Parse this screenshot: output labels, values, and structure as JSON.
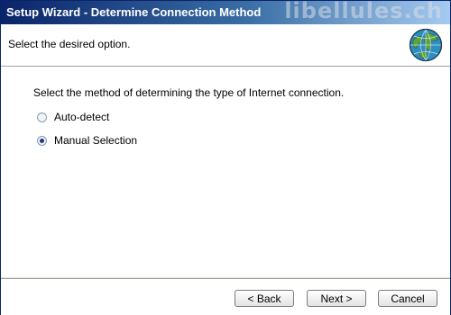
{
  "window": {
    "title": "Setup Wizard - Determine Connection Method",
    "watermark": "libellules.ch"
  },
  "header": {
    "instruction": "Select the desired option.",
    "icon": "globe-icon"
  },
  "content": {
    "prompt": "Select the method of determining the type of Internet connection.",
    "options": [
      {
        "label": "Auto-detect",
        "selected": false
      },
      {
        "label": "Manual Selection",
        "selected": true
      }
    ]
  },
  "footer": {
    "back_label": "< Back",
    "next_label": "Next >",
    "cancel_label": "Cancel"
  },
  "colors": {
    "titlebar_start": "#0a246a",
    "titlebar_end": "#a6caf0",
    "radio_dot": "#21397f"
  }
}
